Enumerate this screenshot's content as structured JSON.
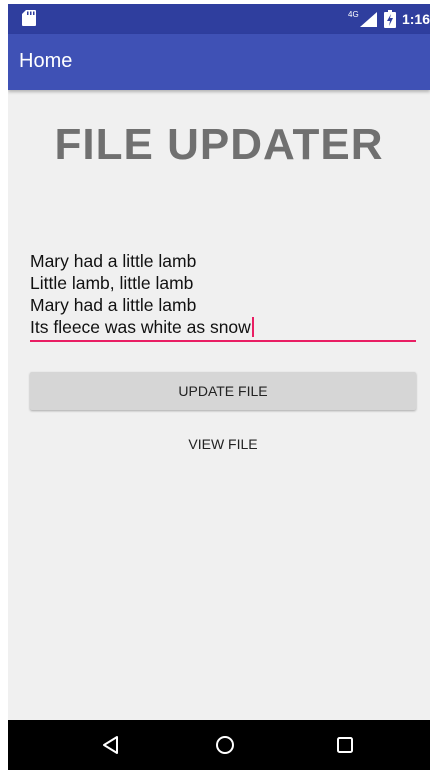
{
  "status_bar": {
    "network_label": "4G",
    "time": "1:16",
    "icons": [
      "sd-card-icon",
      "signal-icon",
      "battery-charging-icon"
    ]
  },
  "app_bar": {
    "title": "Home"
  },
  "main": {
    "headline": "FILE UPDATER",
    "text_field": {
      "lines": [
        "Mary had a little lamb",
        "Little lamb, little lamb",
        "Mary had a little lamb",
        "Its fleece was white as snow"
      ]
    },
    "update_button_label": "UPDATE FILE",
    "view_button_label": "VIEW FILE"
  },
  "nav_bar": {
    "icons": [
      "back-icon",
      "home-icon",
      "recents-icon"
    ]
  },
  "colors": {
    "status_bar": "#2f3e9e",
    "app_bar": "#3f51b5",
    "accent": "#e91e63",
    "background": "#f0f0f0"
  }
}
